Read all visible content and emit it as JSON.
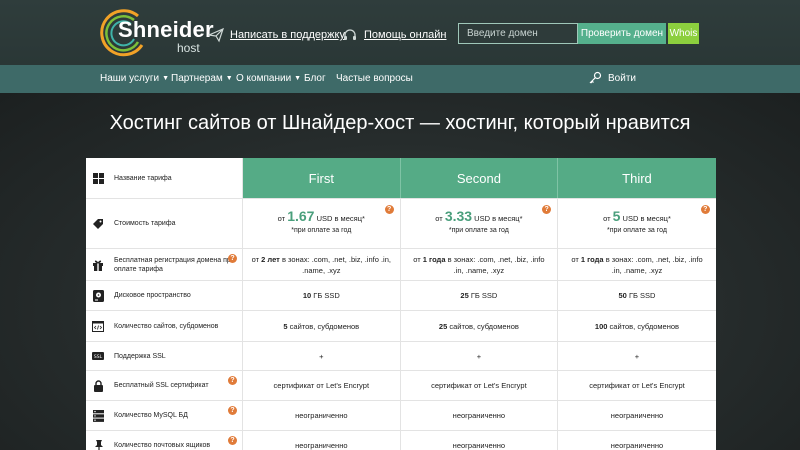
{
  "header": {
    "logo_main": "Shneider",
    "logo_sub": "host",
    "support_link": "Написать в поддержку",
    "online_help_link": "Помощь онлайн",
    "domain_placeholder": "Введите домен",
    "check_button": "Проверить домен",
    "whois_button": "Whois"
  },
  "nav": {
    "items": [
      {
        "label": "Наши услуги",
        "dropdown": true
      },
      {
        "label": "Партнерам",
        "dropdown": true
      },
      {
        "label": "О компании",
        "dropdown": true
      },
      {
        "label": "Блог",
        "dropdown": false
      },
      {
        "label": "Частые вопросы",
        "dropdown": false
      }
    ],
    "login_label": "Войти"
  },
  "hero": {
    "title": "Хостинг сайтов от Шнайдер-хост — хостинг, который нравится"
  },
  "table": {
    "header_label": "Название тарифа",
    "plans": [
      "First",
      "Second",
      "Third"
    ],
    "price": {
      "label": "Стоимость тарифа",
      "prefix": "от",
      "values": [
        "1.67",
        "3.33",
        "5"
      ],
      "suffix": "USD в месяц*",
      "note": "*при оплате за год"
    },
    "domain_reg": {
      "label": "Бесплатная регистрация домена при оплате тарифа",
      "prefix": "от",
      "periods": [
        "2 лет",
        "1 года",
        "1 года"
      ],
      "zones": "в зонах: .com, .net, .biz, .info .in, .name, .xyz"
    },
    "disk": {
      "label": "Дисковое пространство",
      "values": [
        "10",
        "25",
        "50"
      ],
      "unit": "ГБ SSD"
    },
    "sites": {
      "label": "Количество сайтов, субдоменов",
      "values": [
        "5",
        "25",
        "100"
      ],
      "unit": "сайтов, субдоменов"
    },
    "ssl_support": {
      "label": "Поддержка SSL",
      "values": [
        "+",
        "+",
        "+"
      ]
    },
    "free_ssl": {
      "label": "Бесплатный SSL сертификат",
      "values": [
        "сертификат от Let's Encrypt",
        "сертификат от Let's Encrypt",
        "сертификат от Let's Encrypt"
      ]
    },
    "mysql": {
      "label": "Количество MySQL БД",
      "values": [
        "неограниченно",
        "неограниченно",
        "неограниченно"
      ]
    },
    "mailboxes": {
      "label": "Количество почтовых ящиков",
      "values": [
        "неограниченно",
        "неограниченно",
        "неограниченно"
      ]
    },
    "tooltip_mark": "?"
  },
  "colors": {
    "header_bg": "#2f3d3c",
    "nav_bg": "#3e6a68",
    "plan_header": "#55ab86",
    "check_button": "#55b08d",
    "whois_button": "#8ccf3e",
    "tooltip": "#e07b39",
    "price": "#4a9f7c"
  },
  "icons": {
    "support": "paper-plane-icon",
    "online_help": "headset-icon",
    "login": "key-icon",
    "plan_name": "grid-icon",
    "price": "tag-icon",
    "domain": "gift-icon",
    "disk": "hard-drive-icon",
    "sites": "code-window-icon",
    "ssl": "ssl-badge-icon",
    "free_ssl": "lock-icon",
    "mysql": "server-icon",
    "mailboxes": "pin-icon"
  }
}
